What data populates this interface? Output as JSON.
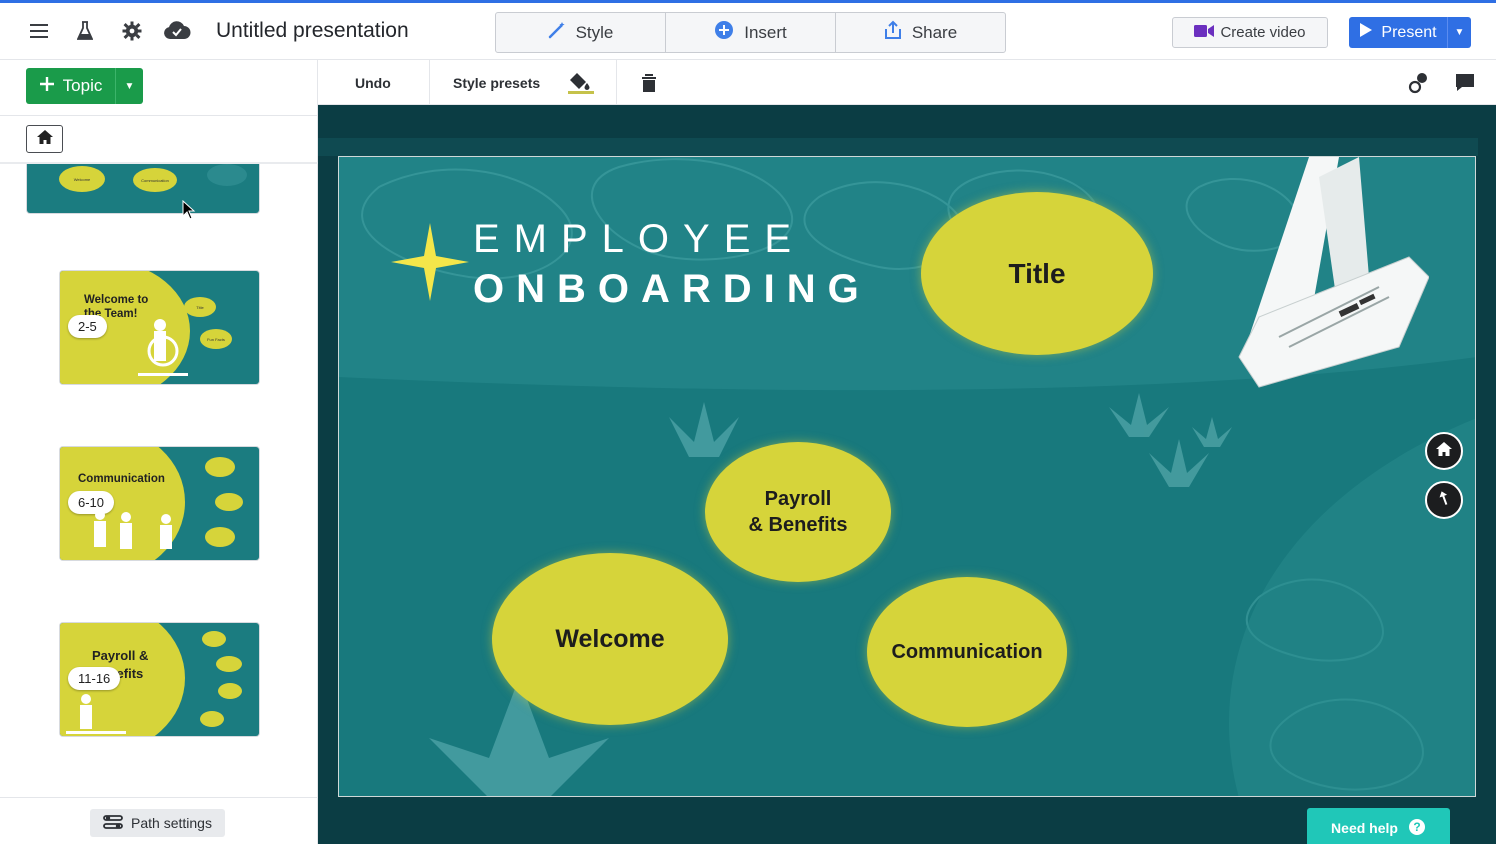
{
  "app": {
    "title": "Untitled presentation"
  },
  "topbar": {
    "menu_icon": "hamburger-menu-icon",
    "lab_icon": "flask-icon",
    "settings_icon": "gear-icon",
    "cloud_icon": "cloud-check-icon",
    "tabs": [
      {
        "label": "Style",
        "icon": "magic-wand-icon"
      },
      {
        "label": "Insert",
        "icon": "plus-circle-icon"
      },
      {
        "label": "Share",
        "icon": "share-upload-icon"
      }
    ],
    "create_video_label": "Create video",
    "present_label": "Present"
  },
  "sidebar": {
    "topic_label": "Topic",
    "path_settings_label": "Path settings",
    "thumbnails": [
      {
        "title": "",
        "range": "",
        "mini_labels": [
          "Welcome",
          "Communication"
        ]
      },
      {
        "title": "Welcome to the Team!",
        "range": "2-5",
        "mini_labels": [
          "Title",
          "Fun Facts"
        ]
      },
      {
        "title": "Communication",
        "range": "6-10",
        "mini_labels": [
          "",
          "",
          ""
        ]
      },
      {
        "title": "Payroll & Benefits",
        "range": "11-16",
        "mini_labels": [
          "",
          "",
          "",
          ""
        ]
      }
    ]
  },
  "toolbar": {
    "undo_label": "Undo",
    "style_presets_label": "Style presets"
  },
  "slide": {
    "title_line1": "EMPLOYEE",
    "title_line2": "ONBOARDING",
    "topics": {
      "title": "Title",
      "payroll_line1": "Payroll",
      "payroll_line2": "& Benefits",
      "welcome": "Welcome",
      "communication": "Communication"
    }
  },
  "help": {
    "label": "Need help"
  },
  "colors": {
    "accent_blue": "#2f6fe4",
    "topic_green": "#1a9b4a",
    "slide_teal": "#18797d",
    "canvas_bg": "#0b3d44",
    "topic_yellow": "#d6d43a",
    "help_teal": "#20c7b8",
    "video_purple": "#6b2fbf"
  }
}
